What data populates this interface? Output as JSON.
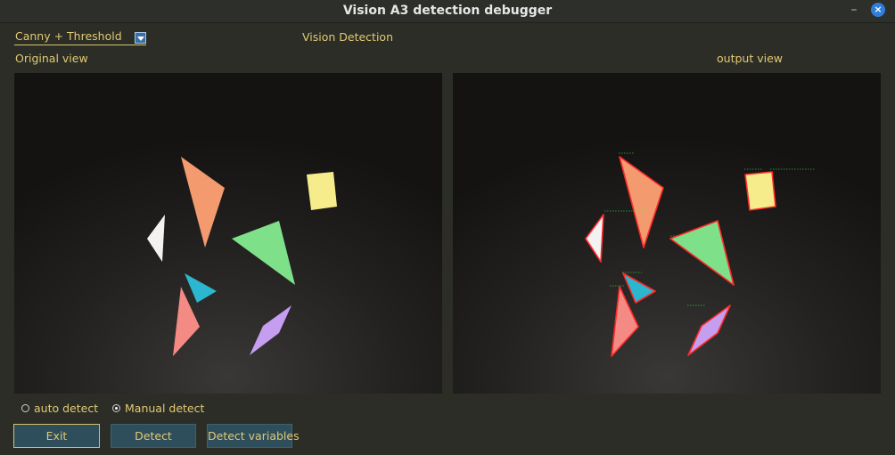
{
  "window": {
    "title": "Vision A3 detection debugger",
    "minimize_glyph": "–",
    "close_glyph": "×"
  },
  "mode_select": {
    "value": "Canny + Threshold"
  },
  "header": {
    "center_label": "Vision Detection"
  },
  "views": {
    "original_label": "Original view",
    "output_label": "output view"
  },
  "detect_mode": {
    "auto_label": "auto detect",
    "manual_label": "Manual detect",
    "selected": "manual"
  },
  "buttons": {
    "exit": "Exit",
    "detect": "Detect",
    "detect_variables": "Detect variables"
  },
  "shapes": [
    {
      "name": "orange-triangle",
      "color": "#f39a6e"
    },
    {
      "name": "yellow-square",
      "color": "#f6ec8c"
    },
    {
      "name": "white-triangle",
      "color": "#f2f2f2"
    },
    {
      "name": "green-triangle",
      "color": "#7fe08a"
    },
    {
      "name": "blue-triangle",
      "color": "#2bb7cf"
    },
    {
      "name": "red-triangle",
      "color": "#f48a84"
    },
    {
      "name": "purple-parallelogram",
      "color": "#c59ef0"
    }
  ],
  "colors": {
    "accent_text": "#e2c973",
    "button_bg": "#2e4e5c",
    "contour": "#ff2a2a",
    "annotation": "#33ff33"
  }
}
